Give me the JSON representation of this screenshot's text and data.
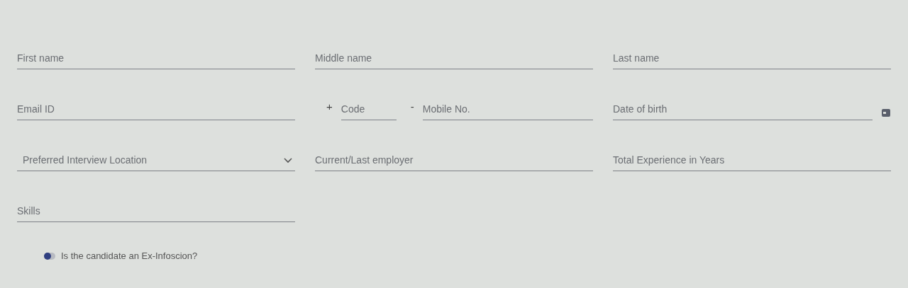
{
  "fields": [
    {
      "kind": "text",
      "placeholder": "First name"
    },
    {
      "kind": "text",
      "placeholder": "Middle name"
    },
    {
      "kind": "text",
      "placeholder": "Last name"
    },
    {
      "kind": "text",
      "placeholder": "Email ID"
    },
    {
      "kind": "phone",
      "prefix": "+",
      "code_placeholder": "Code",
      "separator": "-",
      "placeholder": "Mobile No."
    },
    {
      "kind": "date",
      "placeholder": "Date of birth"
    },
    {
      "kind": "select",
      "placeholder": "Preferred Interview Location"
    },
    {
      "kind": "text",
      "placeholder": "Current/Last employer"
    },
    {
      "kind": "text",
      "placeholder": "Total Experience in Years"
    },
    {
      "kind": "text",
      "placeholder": "Skills"
    }
  ],
  "toggle": {
    "label": "Is the candidate an Ex-Infoscion?",
    "on": false
  }
}
